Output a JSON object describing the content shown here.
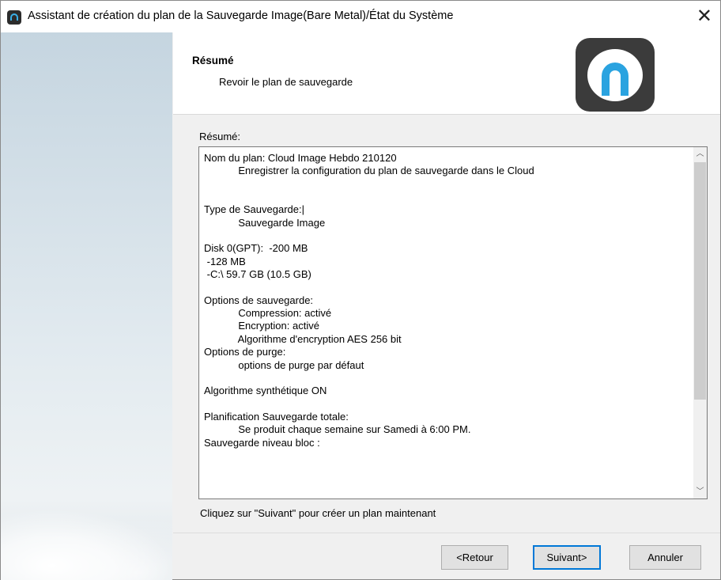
{
  "window": {
    "title": "Assistant de création du plan de la Sauvegarde Image(Bare Metal)/État du Système",
    "close_glyph": "✕"
  },
  "header": {
    "title": "Résumé",
    "subtitle": "Revoir le plan de sauvegarde",
    "logo_icon": "app-logo-icon"
  },
  "summary": {
    "label": "Résumé:",
    "lines": [
      "Nom du plan: Cloud Image Hebdo 210120",
      "            Enregistrer la configuration du plan de sauvegarde dans le Cloud",
      "",
      "",
      "Type de Sauvegarde:|",
      "            Sauvegarde Image",
      "",
      "Disk 0(GPT):  -200 MB",
      " -128 MB",
      " -C:\\ 59.7 GB (10.5 GB)",
      "",
      "Options de sauvegarde:",
      "            Compression: activé",
      "            Encryption: activé",
      "            Algorithme d'encryption AES 256 bit",
      "Options de purge:",
      "            options de purge par défaut",
      "",
      "Algorithme synthétique ON",
      "",
      "Planification Sauvegarde totale:",
      "            Se produit chaque semaine sur Samedi à 6:00 PM.",
      "Sauvegarde niveau bloc :"
    ]
  },
  "hint": "Cliquez sur \"Suivant\" pour créer un plan maintenant",
  "buttons": {
    "back": "<Retour",
    "next": "Suivant>",
    "cancel": "Annuler"
  },
  "scrollbar": {
    "up_glyph": "︿",
    "down_glyph": "﹀"
  }
}
